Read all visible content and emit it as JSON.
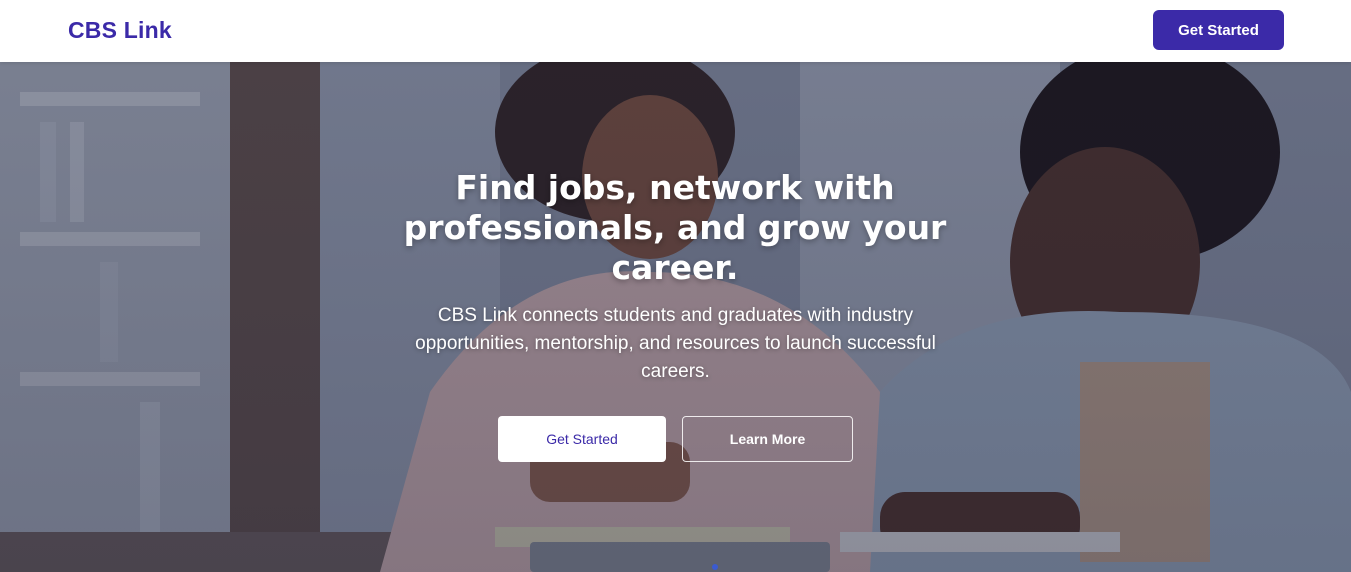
{
  "header": {
    "brand": "CBS Link",
    "cta_label": "Get Started"
  },
  "hero": {
    "title": "Find jobs, network with professionals, and grow your career.",
    "subtitle": "CBS Link connects students and graduates with industry opportunities, mentorship, and resources to launch successful careers.",
    "primary_button": "Get Started",
    "secondary_button": "Learn More",
    "background_image": "photo-students-library-icon"
  },
  "colors": {
    "brand": "#3b2aa8",
    "white": "#ffffff",
    "overlay": "#12163080"
  }
}
